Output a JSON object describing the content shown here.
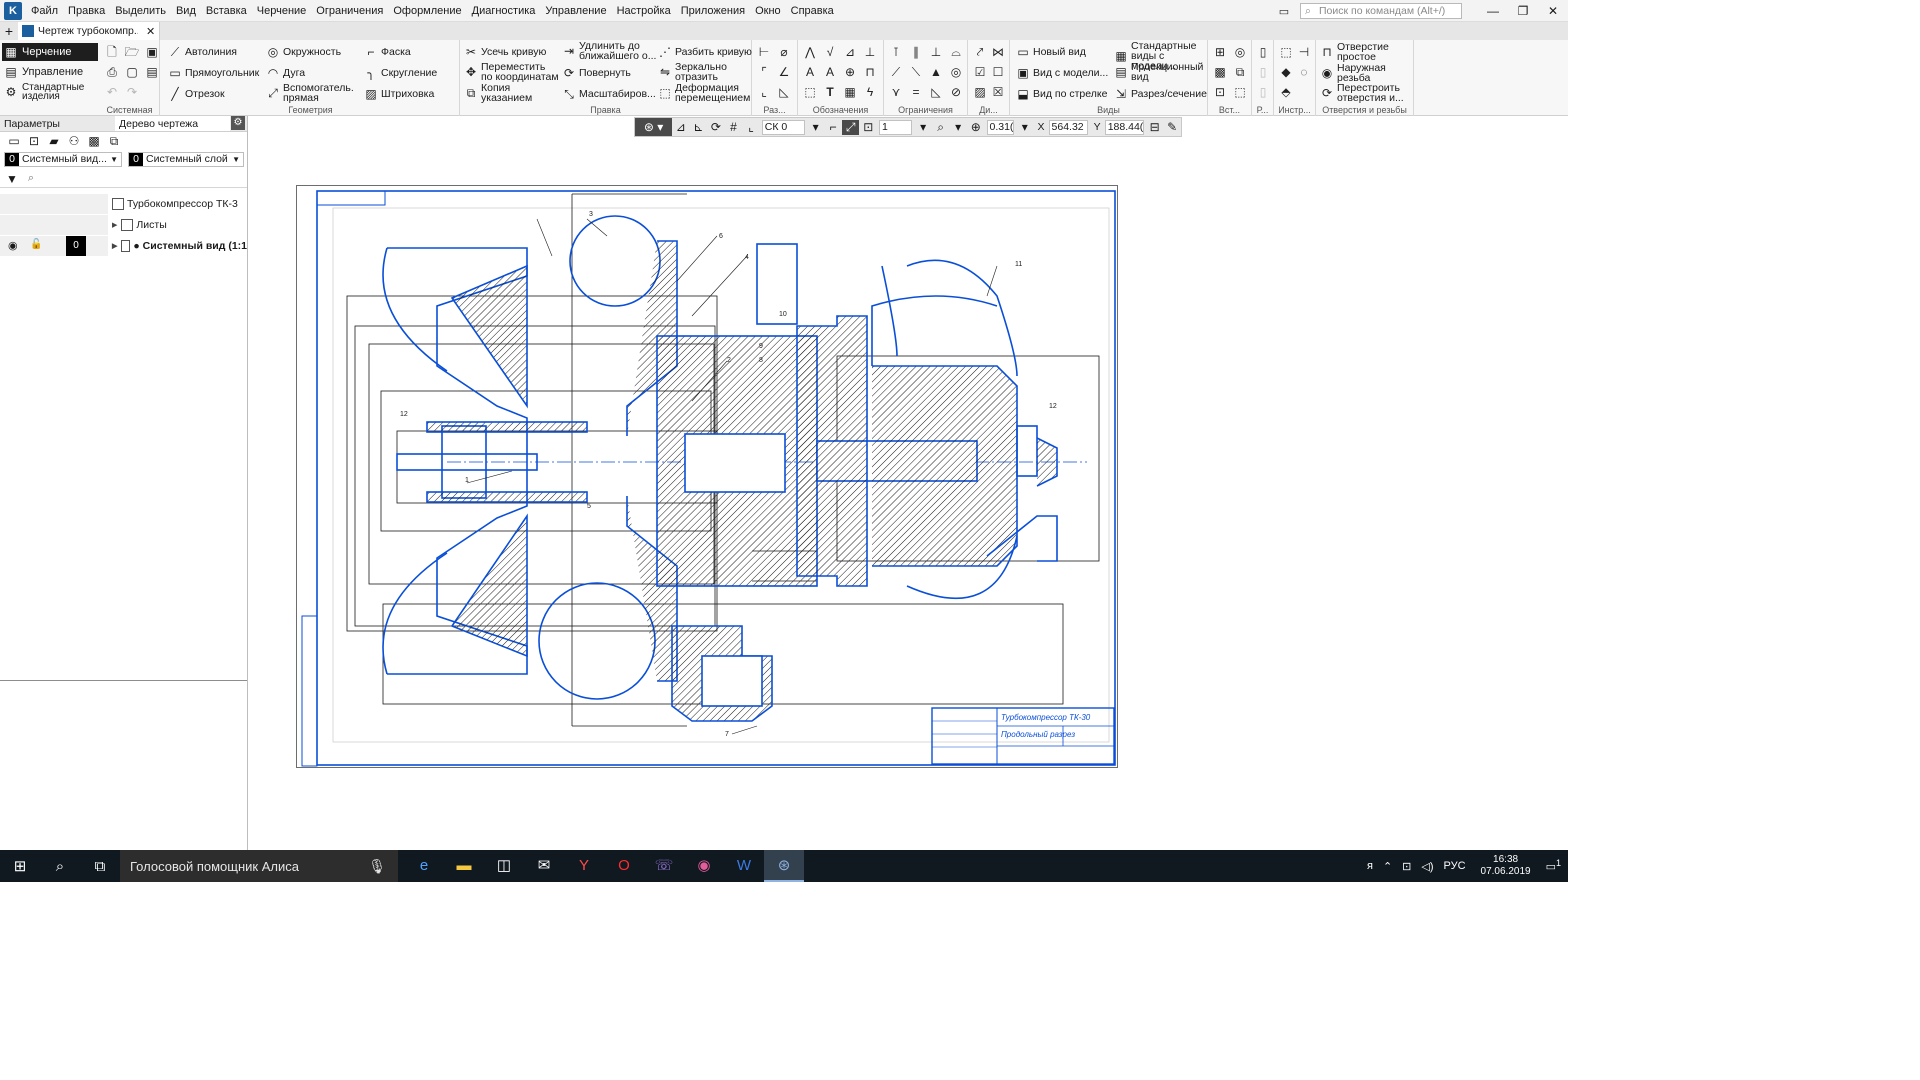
{
  "menu": {
    "logo": "K",
    "items": [
      "Файл",
      "Правка",
      "Выделить",
      "Вид",
      "Вставка",
      "Черчение",
      "Ограничения",
      "Оформление",
      "Диагностика",
      "Управление",
      "Настройка",
      "Приложения",
      "Окно",
      "Справка"
    ],
    "search_placeholder": "Поиск по командам (Alt+/)"
  },
  "doc_tab": {
    "title": "Чертеж турбокомпр..."
  },
  "ribbon": {
    "modes": [
      "Черчение",
      "Управление",
      "Стандартные изделия"
    ],
    "groups": {
      "system": "Системная",
      "geometry": "Геометрия",
      "edit": "Правка",
      "sizes": "Раз...",
      "marks": "Обозначения",
      "constraints": "Ограничения",
      "di": "Ди...",
      "views": "Виды",
      "insert": "Вст...",
      "r": "Р...",
      "instr": "Инстр...",
      "holes": "Отверстия и резьбы"
    },
    "geometry": [
      "Автолиния",
      "Окружность",
      "Фаска",
      "Прямоугольник",
      "Дуга",
      "Скругление",
      "Отрезок",
      "Вспомогатель. прямая",
      "Штриховка"
    ],
    "edit": [
      "Усечь кривую",
      "Удлинить до ближайшего о...",
      "Разбить кривую",
      "Переместить по координатам",
      "Повернуть",
      "Зеркально отразить",
      "Копия указанием",
      "Масштабиров...",
      "Деформация перемещением"
    ],
    "views": [
      "Новый вид",
      "Стандартные виды с модели...",
      "Вид с модели...",
      "Проекционный вид",
      "Вид по стрелке",
      "Разрез/сечение"
    ],
    "holes": [
      "Отверстие простое",
      "Наружная резьба",
      "Перестроить отверстия и..."
    ]
  },
  "panel": {
    "tabs": [
      "Параметры",
      "Дерево чертежа"
    ],
    "view_select": {
      "num": "0",
      "label": "Системный вид..."
    },
    "layer_select": {
      "num": "0",
      "label": "Системный слой"
    },
    "tree": [
      {
        "label": "Турбокомпрессор ТК-3"
      },
      {
        "label": "Листы"
      },
      {
        "label": "● Системный вид (1:1",
        "layer": "0"
      }
    ]
  },
  "draw_toolbar": {
    "cs": "СК 0",
    "step": "1",
    "zoom": "0.31(",
    "x_label": "X",
    "x": "564.32",
    "y_label": "Y",
    "y": "188.44("
  },
  "drawing": {
    "title1": "Турбокомпрессор ТК-30",
    "title2": "Продольный разрез",
    "callouts": [
      "1",
      "2",
      "3",
      "4",
      "5",
      "6",
      "7",
      "8",
      "9",
      "10",
      "11",
      "12",
      "12"
    ],
    "line_color": "#0a4fd8",
    "hatch_color": "#1a1a1a"
  },
  "taskbar": {
    "alisa": "Голосовой помощник Алиса",
    "lang": "РУС",
    "time": "16:38",
    "date": "07.06.2019",
    "notifications": "1"
  }
}
